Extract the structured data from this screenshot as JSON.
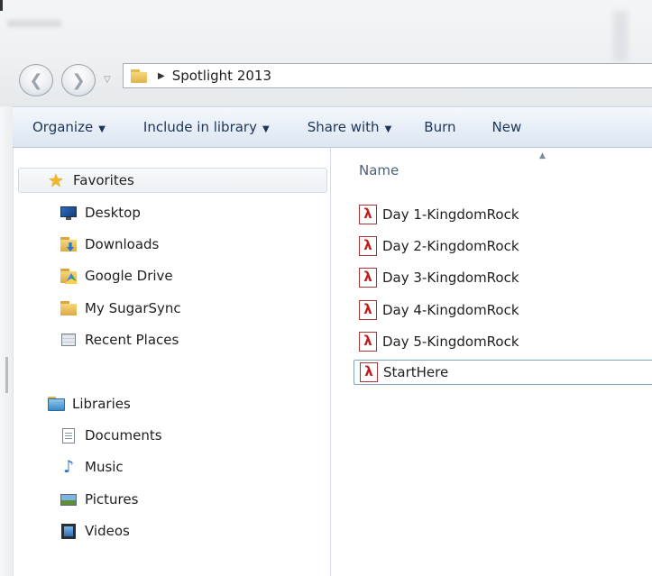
{
  "address_bar": {
    "path": "Spotlight 2013"
  },
  "toolbar": {
    "organize": "Organize",
    "include_in_library": "Include in library",
    "share_with": "Share with",
    "burn": "Burn",
    "new_folder": "New"
  },
  "nav_pane": {
    "favorites": {
      "label": "Favorites",
      "items": [
        {
          "label": "Desktop",
          "icon": "desktop-icon"
        },
        {
          "label": "Downloads",
          "icon": "downloads-folder-icon"
        },
        {
          "label": "Google Drive",
          "icon": "google-drive-folder-icon"
        },
        {
          "label": "My SugarSync",
          "icon": "folder-icon"
        },
        {
          "label": "Recent Places",
          "icon": "recent-places-icon"
        }
      ]
    },
    "libraries": {
      "label": "Libraries",
      "items": [
        {
          "label": "Documents",
          "icon": "documents-icon"
        },
        {
          "label": "Music",
          "icon": "music-icon"
        },
        {
          "label": "Pictures",
          "icon": "pictures-icon"
        },
        {
          "label": "Videos",
          "icon": "videos-icon"
        }
      ]
    }
  },
  "file_list": {
    "column_header": "Name",
    "files": [
      {
        "name": "Day 1-KingdomRock",
        "icon": "pdf-icon"
      },
      {
        "name": "Day 2-KingdomRock",
        "icon": "pdf-icon"
      },
      {
        "name": "Day 3-KingdomRock",
        "icon": "pdf-icon"
      },
      {
        "name": "Day 4-KingdomRock",
        "icon": "pdf-icon"
      },
      {
        "name": "Day 5-KingdomRock",
        "icon": "pdf-icon"
      },
      {
        "name": "StartHere",
        "icon": "pdf-icon"
      }
    ]
  },
  "colors": {
    "command_bar_text": "#1e3555",
    "column_header_text": "#4c607a",
    "pdf_red": "#c21a1a"
  }
}
